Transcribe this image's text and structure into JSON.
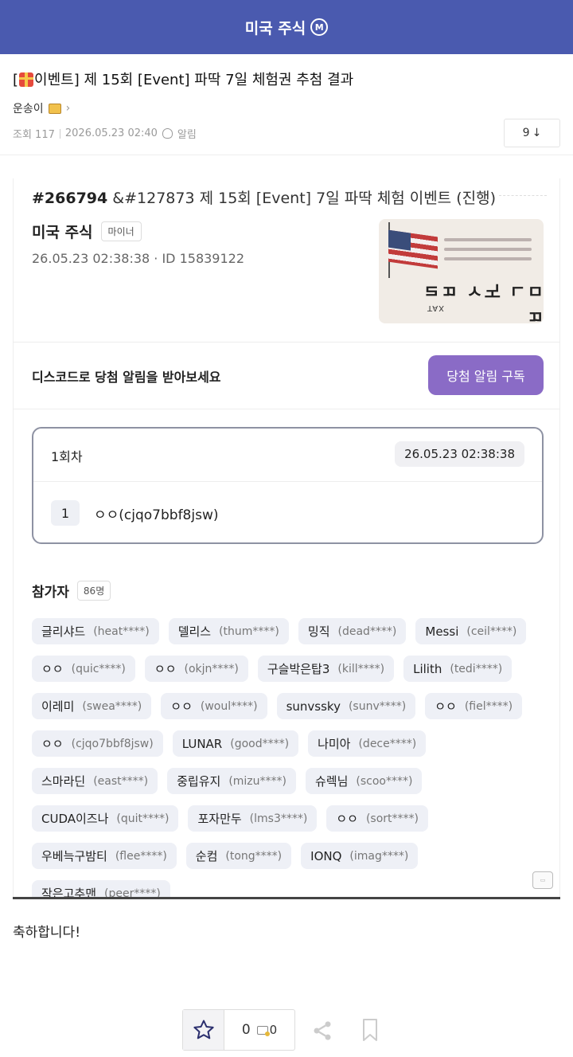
{
  "header": {
    "title": "미국 주식",
    "badge": "M"
  },
  "post": {
    "title_prefix": "[",
    "title_rest": "이벤트] 제 15회 [Event] 파딱 7일 체험권 추첨 결과",
    "author": "운송이",
    "views": "조회 117",
    "datetime": "2026.05.23 02:40",
    "alert_label": "알림",
    "comment_count": "9",
    "body_text": "축하합니다!"
  },
  "embed": {
    "event_number": "#266794",
    "event_title": " &#127873 제 15회 [Event] 7일 파딱 체험 이벤트 (진행)",
    "channel": "미국 주식",
    "channel_tag": "마이너",
    "date_id": "26.05.23 02:38:38 · ID 15839122",
    "discord_text": "디스코드로 당첨 알림을 받아보세요",
    "subscribe_button": "당첨 알림 구독",
    "round_label": "1회차",
    "round_date": "26.05.23 02:38:38",
    "winner_rank": "1",
    "winner_name": "ㅇㅇ(cjqo7bbf8jsw)",
    "participants_label": "참가자",
    "participants_count": "86명",
    "participants": [
      {
        "name": "글리샤드",
        "id": "(heat****)"
      },
      {
        "name": "델리스",
        "id": "(thum****)"
      },
      {
        "name": "밍직",
        "id": "(dead****)"
      },
      {
        "name": "Messi",
        "id": "(ceil****)"
      },
      {
        "name": "ㅇㅇ",
        "id": "(quic****)"
      },
      {
        "name": "ㅇㅇ",
        "id": "(okjn****)"
      },
      {
        "name": "구슬박은탑3",
        "id": "(kill****)"
      },
      {
        "name": "Lilith",
        "id": "(tedi****)"
      },
      {
        "name": "이레미",
        "id": "(swea****)"
      },
      {
        "name": "ㅇㅇ",
        "id": "(woul****)"
      },
      {
        "name": "sunvssky",
        "id": "(sunv****)"
      },
      {
        "name": "ㅇㅇ",
        "id": "(fiel****)"
      },
      {
        "name": "ㅇㅇ",
        "id": "(cjqo7bbf8jsw)"
      },
      {
        "name": "LUNAR",
        "id": "(good****)"
      },
      {
        "name": "나미아",
        "id": "(dece****)"
      },
      {
        "name": "스마라딘",
        "id": "(east****)"
      },
      {
        "name": "중립유지",
        "id": "(mizu****)"
      },
      {
        "name": "슈렉님",
        "id": "(scoo****)"
      },
      {
        "name": "CUDA이즈나",
        "id": "(quit****)"
      },
      {
        "name": "포자만두",
        "id": "(lms3****)"
      },
      {
        "name": "ㅇㅇ",
        "id": "(sort****)"
      },
      {
        "name": "우베늑구밤티",
        "id": "(flee****)"
      },
      {
        "name": "순컴",
        "id": "(tong****)"
      },
      {
        "name": "IONQ",
        "id": "(imag****)"
      },
      {
        "name": "작은고추맨",
        "id": "(peer****)"
      }
    ]
  },
  "actions": {
    "star_count": "0",
    "coin_count": "0"
  },
  "colors": {
    "header_bg": "#4a5aaf",
    "subscribe_bg": "#8a6bc6"
  }
}
